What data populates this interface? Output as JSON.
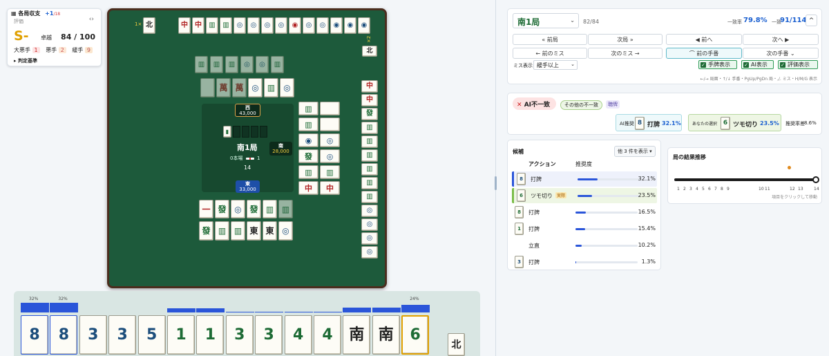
{
  "summary": {
    "title": "各局収支",
    "delta": "+1",
    "delta_unit": "/18",
    "sublabel": "評価",
    "grade": "S-",
    "player": "卓越",
    "score": "84 / 100",
    "mistakes": [
      {
        "label": "大悪手",
        "count": "1"
      },
      {
        "label": "悪手",
        "count": "2"
      },
      {
        "label": "緩手",
        "count": "9"
      }
    ],
    "criteria": "判定基準",
    "collapse_glyph": "‹›"
  },
  "table": {
    "round": "南1局",
    "honba": "0本場",
    "riichi_sticks": "1",
    "wall_remaining": "14",
    "seats": [
      {
        "wind": "西",
        "score": "43,000"
      },
      {
        "wind": "南",
        "score": "28,000"
      },
      {
        "wind": "東",
        "score": "33,000"
      }
    ],
    "top_multiplier": "1×",
    "right_multiplier": "×2"
  },
  "hand": {
    "bar_percents": [
      "32%",
      "32%",
      "",
      "",
      "",
      "",
      "",
      "",
      "",
      "",
      "",
      "",
      "",
      "24%"
    ],
    "tiles": [
      {
        "face": "8",
        "kind": "p"
      },
      {
        "face": "8",
        "kind": "p"
      },
      {
        "face": "3",
        "kind": "p"
      },
      {
        "face": "3",
        "kind": "p"
      },
      {
        "face": "5",
        "kind": "p"
      },
      {
        "face": "1",
        "kind": "s"
      },
      {
        "face": "1",
        "kind": "s"
      },
      {
        "face": "3",
        "kind": "s"
      },
      {
        "face": "3",
        "kind": "s"
      },
      {
        "face": "4",
        "kind": "s"
      },
      {
        "face": "4",
        "kind": "s"
      },
      {
        "face": "南",
        "kind": "z"
      },
      {
        "face": "南",
        "kind": "z"
      },
      {
        "face": "6",
        "kind": "s"
      }
    ],
    "draw": {
      "face": "北",
      "kind": "z"
    }
  },
  "nav": {
    "round_select": "南1局",
    "progress": "82/84",
    "agree_rate_label": "一致率",
    "agree_rate": "79.8%",
    "agree_count_label": "一致",
    "agree_count": "91/114",
    "collapse": "^",
    "buttons_row1": [
      "« 前局",
      "次局 »",
      "◀ 前へ",
      "次へ ▶"
    ],
    "buttons_row2": [
      "← 前のミス",
      "次のミス →",
      "⌒ 前の手番",
      "次の手番 ⌄"
    ],
    "miss_label": "ミス表示",
    "miss_select": "緩手以上",
    "toggles": [
      "手牌表示",
      "AI表示",
      "評価表示"
    ],
    "shortcuts": "←/→ 局面・↑/↓ 手番・PgUp/PgDn 局・,/. ミス・H/M/G 表示"
  },
  "verdict": {
    "badge": "AI不一致",
    "tag1": "その他の不一致",
    "tag2": "聴牌",
    "ai_label": "AI推奨",
    "ai_action": "打牌",
    "ai_pct": "32.1%",
    "you_label": "あなたの選択",
    "you_action": "ツモ切り",
    "you_pct": "23.5%",
    "diff_label": "推奨率差",
    "diff": "8.6%"
  },
  "candidates": {
    "title": "候補",
    "more": "他 3 件を表示 ▾",
    "col_action": "アクション",
    "col_rate": "推奨度",
    "rows": [
      {
        "tile": "8p",
        "action": "打牌",
        "tag": "",
        "pct": "32.1%",
        "value": 32.1
      },
      {
        "tile": "6s",
        "action": "ツモ切り",
        "tag": "実際",
        "pct": "23.5%",
        "value": 23.5
      },
      {
        "tile": "8s",
        "action": "打牌",
        "tag": "",
        "pct": "16.5%",
        "value": 16.5
      },
      {
        "tile": "1s",
        "action": "打牌",
        "tag": "",
        "pct": "15.4%",
        "value": 15.4
      },
      {
        "tile": "",
        "action": "立直",
        "tag": "",
        "pct": "10.2%",
        "value": 10.2
      },
      {
        "tile": "3p",
        "action": "打牌",
        "tag": "",
        "pct": "1.3%",
        "value": 1.3
      }
    ]
  },
  "trend": {
    "title": "局の結果推移",
    "ticks": [
      "1",
      "2",
      "3",
      "4",
      "5",
      "6",
      "7",
      "8",
      "9",
      "10",
      "11",
      "12",
      "13",
      "14"
    ],
    "current_index": 12,
    "hint": "項目をクリックして移動"
  },
  "colors": {
    "accent": "#1a5fd0",
    "felt": "#1d5a3b",
    "danger": "#d33a3a"
  }
}
